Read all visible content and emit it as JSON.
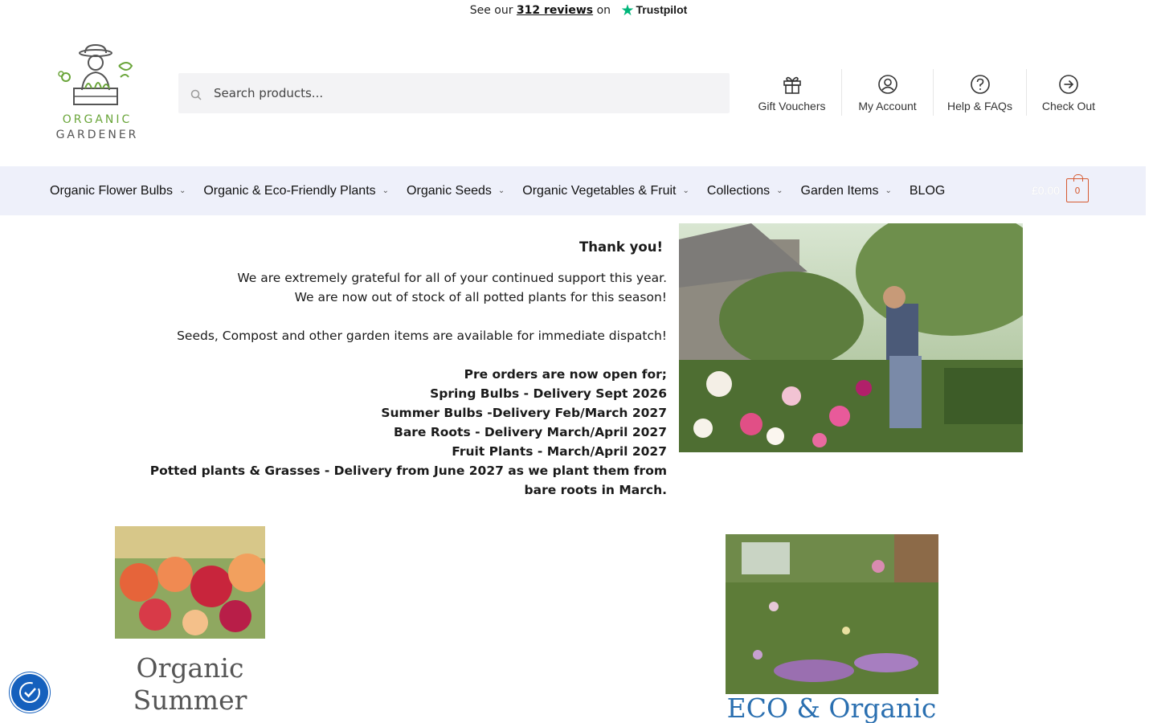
{
  "topbar": {
    "prefix": "See our",
    "reviews": "312 reviews",
    "suffix": "on",
    "brand": "Trustpilot"
  },
  "logo": {
    "line1": "ORGANIC",
    "line2": "GARDENER"
  },
  "search": {
    "placeholder": "Search products..."
  },
  "header_links": [
    {
      "label": "Gift Vouchers",
      "icon": "gift-icon"
    },
    {
      "label": "My Account",
      "icon": "user-icon"
    },
    {
      "label": "Help & FAQs",
      "icon": "question-icon"
    },
    {
      "label": "Check Out",
      "icon": "arrow-right-circle-icon"
    }
  ],
  "nav": {
    "items": [
      {
        "label": "Organic Flower Bulbs"
      },
      {
        "label": "Organic & Eco-Friendly Plants"
      },
      {
        "label": "Organic Seeds"
      },
      {
        "label": "Organic Vegetables & Fruit"
      },
      {
        "label": "Collections"
      },
      {
        "label": "Garden Items"
      },
      {
        "label": "BLOG"
      }
    ],
    "cart_amount": "£0.00",
    "cart_count": "0"
  },
  "message": {
    "title": "Thank you!",
    "line1": "We are extremely grateful for all of your continued support this year.",
    "line2": "We are now out of stock of all potted plants for this season!",
    "line3": "Seeds, Compost and other garden items are available for immediate dispatch!",
    "preorder_heading": "Pre orders are now open for;",
    "preorders": [
      "Spring Bulbs - Delivery Sept 2026",
      "Summer Bulbs -Delivery Feb/March 2027",
      "Bare Roots - Delivery March/April 2027",
      "Fruit Plants - March/April 2027",
      "Potted plants & Grasses - Delivery from June 2027 as we plant them from bare roots in March."
    ]
  },
  "cards": [
    {
      "title": "Organic Summer"
    },
    {
      "title": "ECO & Organic"
    }
  ],
  "colors": {
    "nav_bg": "#eef0fa",
    "accent_green": "#6aa53a",
    "link_blue": "#2a6fb0",
    "cart_orange": "#d65a31",
    "trustpilot_green": "#00b67a",
    "a11y_blue": "#1560bd"
  }
}
